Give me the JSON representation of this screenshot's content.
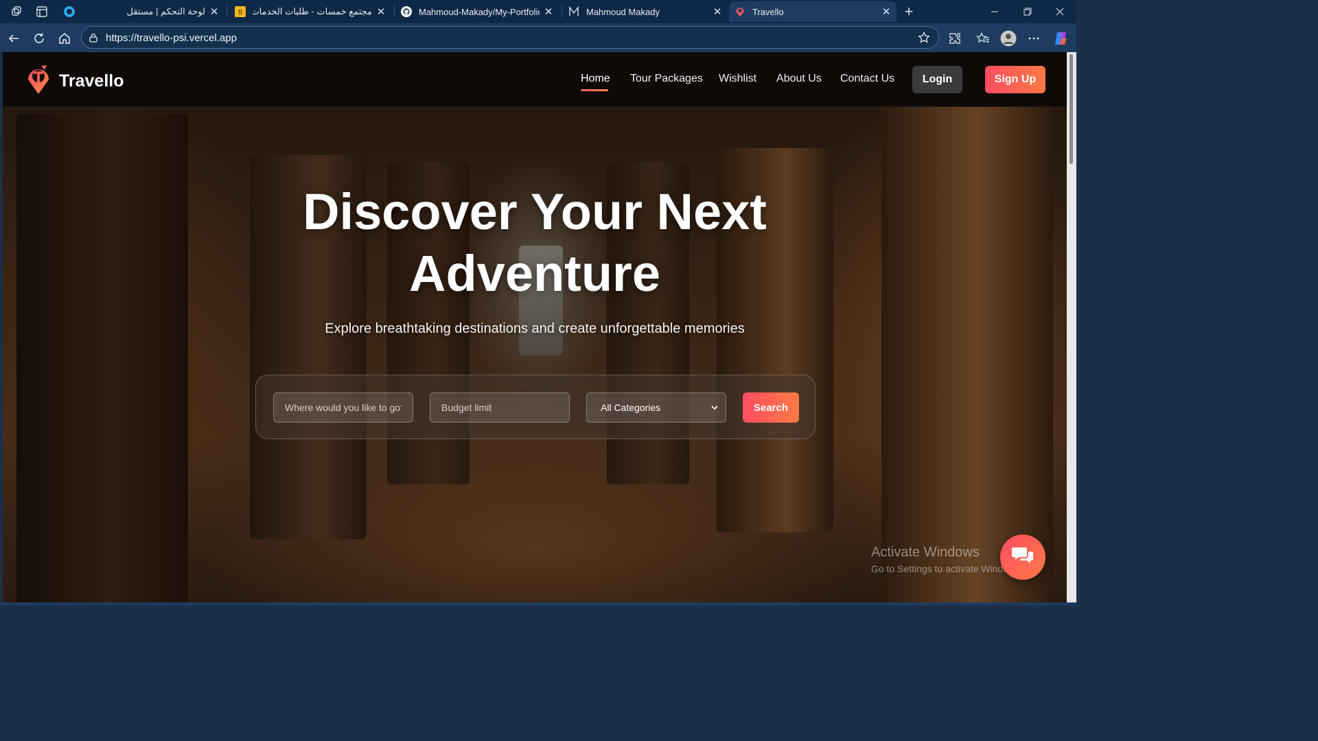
{
  "browser": {
    "tabs": [
      {
        "title": "لوحة التحكم | مستقل",
        "favicon": "mostaql-icon"
      },
      {
        "title": "مجتمع خمسات - طلبات الخدمات",
        "favicon": "khamsat-icon"
      },
      {
        "title": "Mahmoud-Makady/My-Portfolio:",
        "favicon": "github-icon"
      },
      {
        "title": "Mahmoud Makady",
        "favicon": "portfolio-icon"
      },
      {
        "title": "Travello",
        "favicon": "travello-icon",
        "active": true
      }
    ],
    "url": "https://travello-psi.vercel.app"
  },
  "site": {
    "brand": "Travello",
    "nav": {
      "home": "Home",
      "tours": "Tour Packages",
      "wishlist": "Wishlist",
      "about": "About Us",
      "contact": "Contact Us"
    },
    "login": "Login",
    "signup": "Sign Up"
  },
  "hero": {
    "title_line1": "Discover Your Next",
    "title_line2": "Adventure",
    "subtitle": "Explore breathtaking destinations and create unforgettable memories"
  },
  "search": {
    "destination_placeholder": "Where would you like to go?",
    "budget_placeholder": "Budget limit",
    "category_selected": "All Categories",
    "button": "Search"
  },
  "os_watermark": {
    "line1": "Activate Windows",
    "line2": "Go to Settings to activate Windows."
  },
  "colors": {
    "accent_start": "#ff4d62",
    "accent_end": "#ff7a45",
    "browser_frame": "#1f3c60"
  }
}
